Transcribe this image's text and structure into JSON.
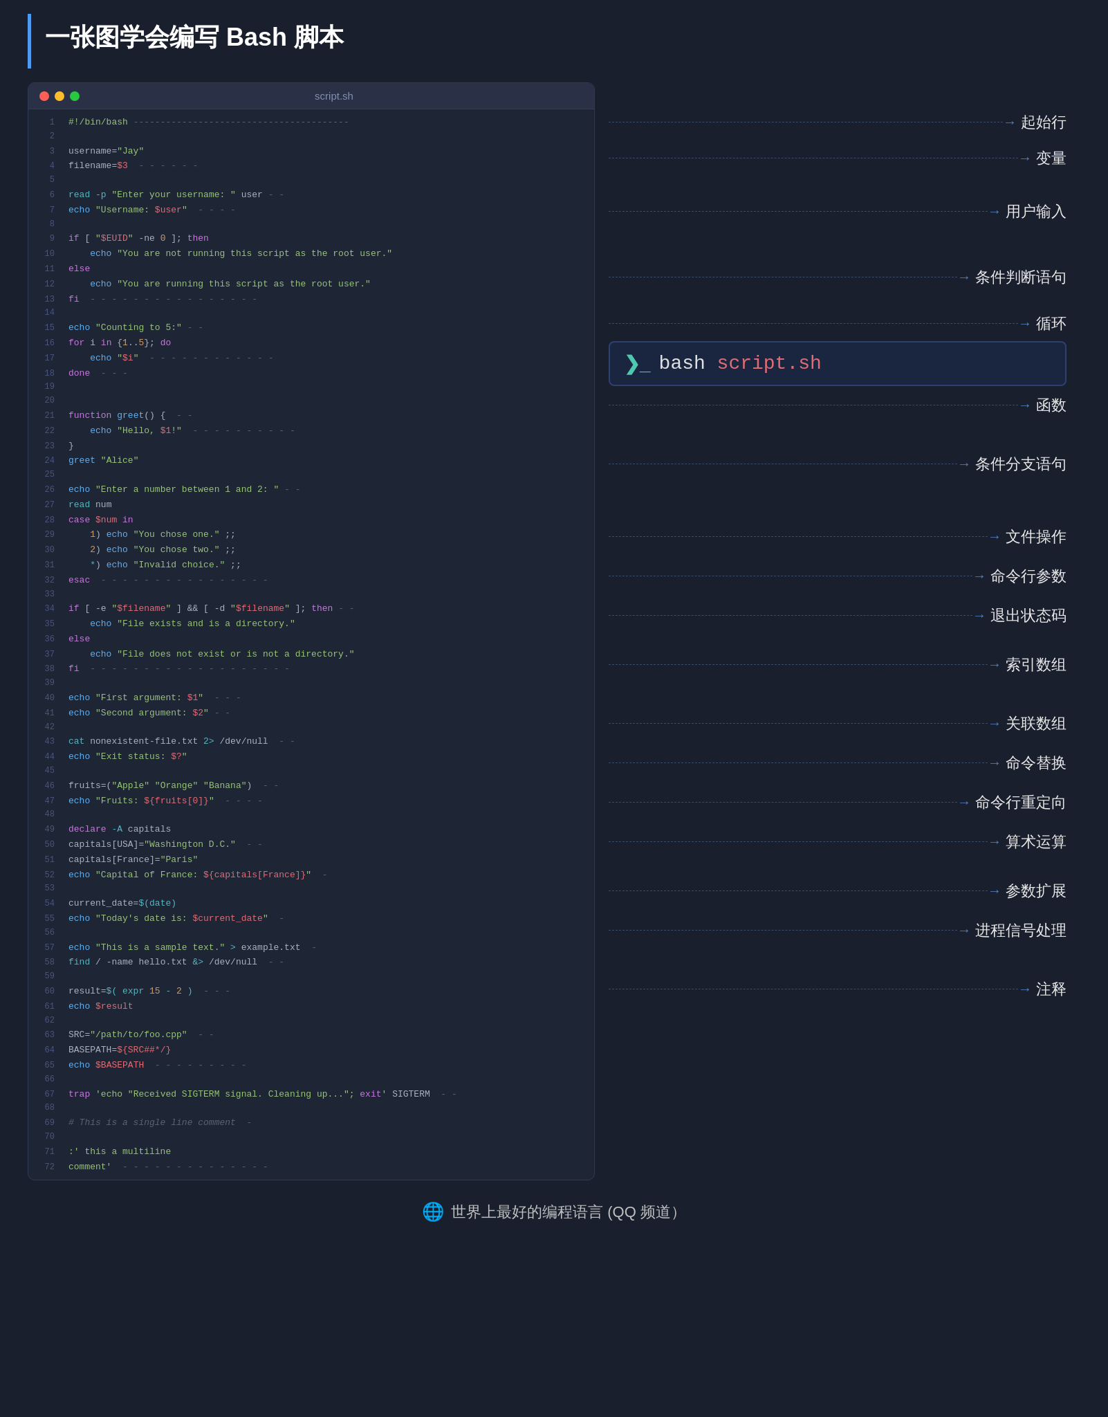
{
  "page": {
    "title": "一张图学会编写 Bash 脚本",
    "footer": "世界上最好的编程语言 (QQ 频道）"
  },
  "editor": {
    "filename": "script.sh",
    "bash_cmd": "bash",
    "bash_arg": "script.sh"
  },
  "annotations": {
    "shebang": "起始行",
    "variable": "变量",
    "user_input": "用户输入",
    "conditional": "条件判断语句",
    "loop": "循环",
    "function": "函数",
    "case": "条件分支语句",
    "file_ops": "文件操作",
    "cmd_args": "命令行参数",
    "exit_code": "退出状态码",
    "array": "索引数组",
    "assoc_array": "关联数组",
    "cmd_sub": "命令替换",
    "redirect": "命令行重定向",
    "arithmetic": "算术运算",
    "param_exp": "参数扩展",
    "signal": "进程信号处理",
    "comment": "注释"
  }
}
